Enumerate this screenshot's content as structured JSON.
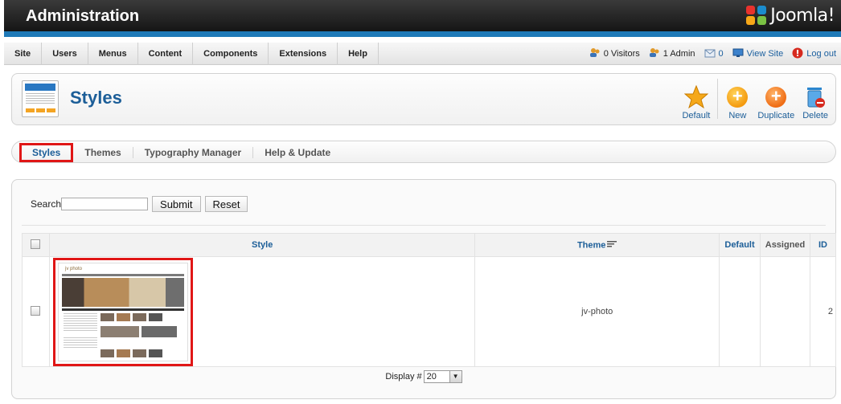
{
  "header": {
    "title": "Administration",
    "logo_text": "Joomla!"
  },
  "menu": {
    "items": [
      "Site",
      "Users",
      "Menus",
      "Content",
      "Components",
      "Extensions",
      "Help"
    ]
  },
  "status": {
    "visitors": "0 Visitors",
    "admins": "1 Admin",
    "messages": "0",
    "view_site": "View Site",
    "logout": "Log out"
  },
  "toolbar": {
    "page_title": "Styles",
    "default_label": "Default",
    "new_label": "New",
    "duplicate_label": "Duplicate",
    "delete_label": "Delete"
  },
  "subnav": {
    "tabs": [
      "Styles",
      "Themes",
      "Typography Manager",
      "Help & Update"
    ],
    "active": "Styles"
  },
  "search": {
    "label": "Search",
    "value": "",
    "submit_label": "Submit",
    "reset_label": "Reset"
  },
  "table": {
    "headers": {
      "style": "Style",
      "theme": "Theme",
      "default": "Default",
      "assigned": "Assigned",
      "id": "ID"
    },
    "rows": [
      {
        "style_thumbnail": "jv-photo template preview",
        "theme": "jv-photo",
        "default": "",
        "assigned": "",
        "id": "2"
      }
    ]
  },
  "pager": {
    "label": "Display #",
    "value": "20"
  },
  "colors": {
    "accent": "#1c5e98",
    "header_bar": "#1f7ab8",
    "highlight": "#e01616"
  }
}
